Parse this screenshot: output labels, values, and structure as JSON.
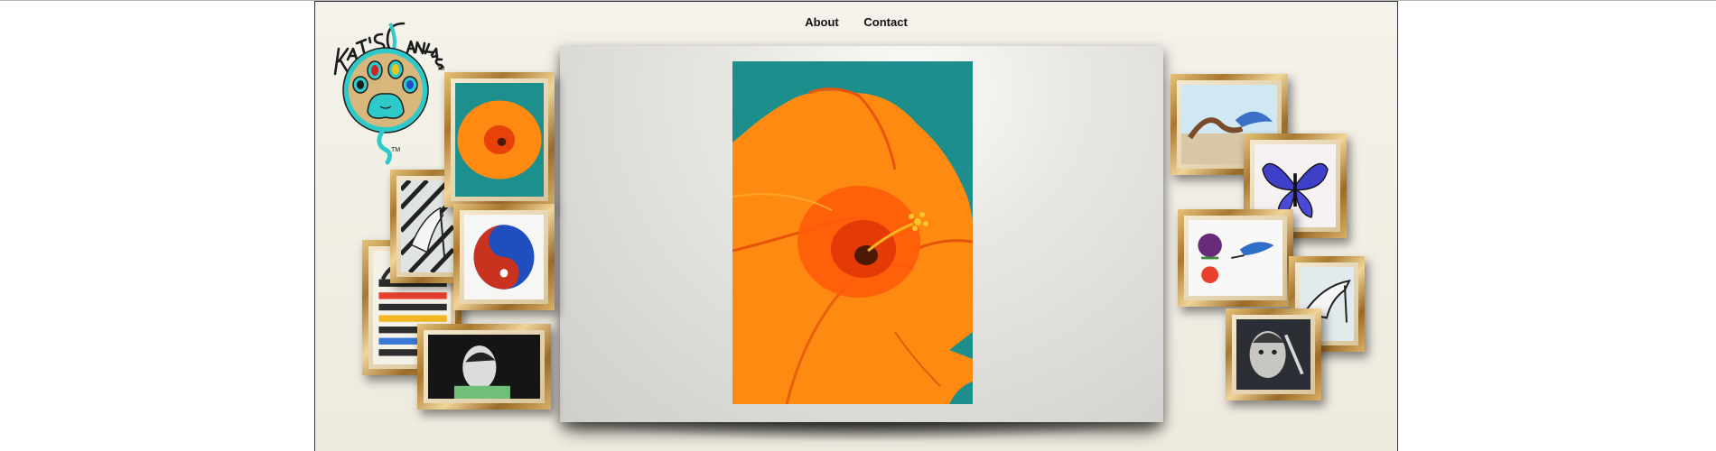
{
  "nav": {
    "items": [
      {
        "label": "About"
      },
      {
        "label": "Contact"
      }
    ]
  },
  "logo": {
    "brand_text": "Kat's Canvas",
    "tm": "™",
    "colors": {
      "paw": "#2ec9c9",
      "disc": "#d8b77c",
      "stroke": "#1c1c1c"
    }
  },
  "featured": {
    "subject": "orange hibiscus flower painting"
  },
  "gallery": {
    "left": [
      {
        "subject": "orange hibiscus"
      },
      {
        "subject": "zebra-print high heel shoe"
      },
      {
        "subject": "red and blue yin-yang"
      },
      {
        "subject": "rainbow zebra"
      },
      {
        "subject": "portrait with money"
      }
    ],
    "right": [
      {
        "subject": "mermaid and dolphin"
      },
      {
        "subject": "blue butterfly"
      },
      {
        "subject": "purple flowers and hummingbird"
      },
      {
        "subject": "high heel sketch"
      },
      {
        "subject": "face portrait"
      }
    ]
  },
  "colors": {
    "background": "#f1eee5",
    "stage": "#dedcd8",
    "frame_gold": "#c7994a",
    "teal": "#1f8f8f",
    "orange": "#ff8a12"
  }
}
